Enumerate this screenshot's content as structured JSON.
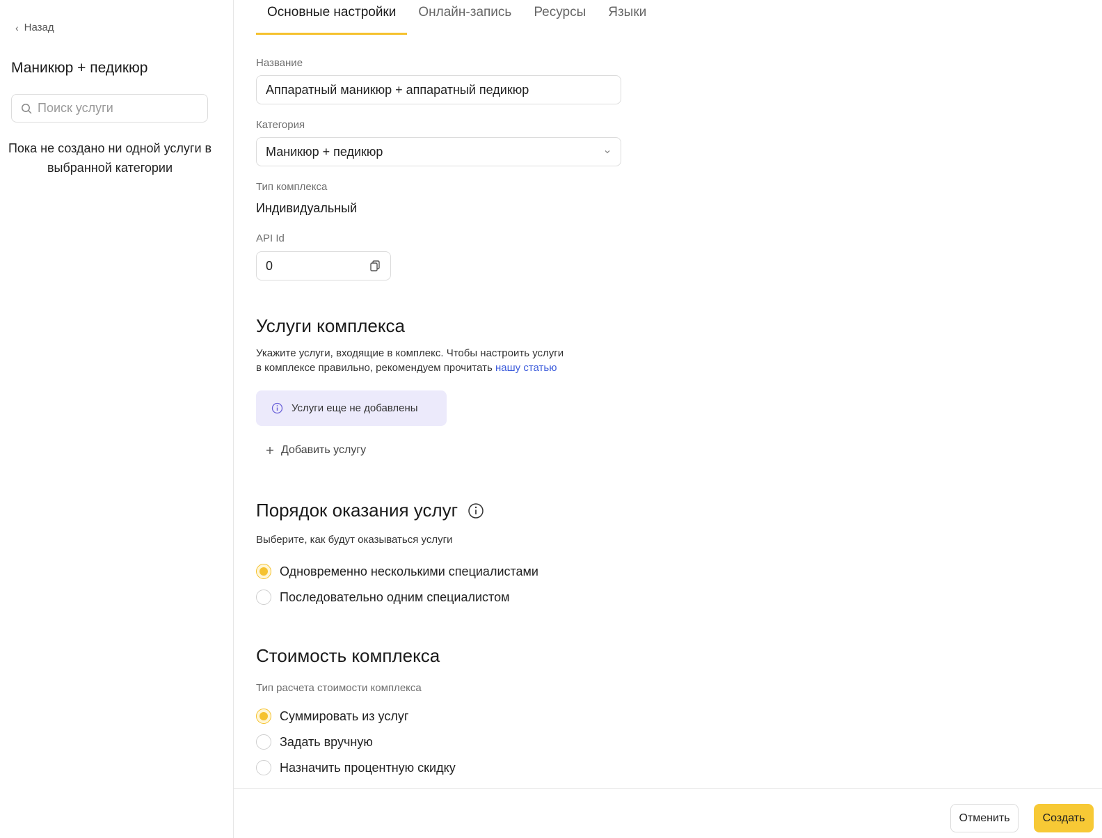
{
  "sidebar": {
    "back_label": "Назад",
    "title": "Маникюр + педикюр",
    "search_placeholder": "Поиск услуги",
    "empty_message": "Пока не создано ни одной услуги в выбранной категории"
  },
  "tabs": [
    {
      "label": "Основные настройки",
      "active": true
    },
    {
      "label": "Онлайн-запись",
      "active": false
    },
    {
      "label": "Ресурсы",
      "active": false
    },
    {
      "label": "Языки",
      "active": false
    }
  ],
  "form": {
    "name_label": "Название",
    "name_value": "Аппаратный маникюр + аппаратный педикюр",
    "category_label": "Категория",
    "category_value": "Маникюр + педикюр",
    "complex_type_label": "Тип комплекса",
    "complex_type_value": "Индивидуальный",
    "api_id_label": "API Id",
    "api_id_value": "0"
  },
  "services_section": {
    "title": "Услуги комплекса",
    "description_line1": "Укажите услуги, входящие в комплекс. Чтобы настроить услуги",
    "description_line2": "в комплексе правильно, рекомендуем прочитать ",
    "link_text": "нашу статью",
    "empty_info": "Услуги еще не добавлены",
    "add_button": "Добавить услугу"
  },
  "order_section": {
    "title": "Порядок оказания услуг",
    "subtitle": "Выберите, как будут оказываться услуги",
    "options": [
      {
        "label": "Одновременно несколькими специалистами",
        "checked": true
      },
      {
        "label": "Последовательно одним специалистом",
        "checked": false
      }
    ]
  },
  "cost_section": {
    "title": "Стоимость комплекса",
    "calc_label": "Тип расчета стоимости комплекса",
    "options": [
      {
        "label": "Суммировать из услуг",
        "checked": true
      },
      {
        "label": "Задать вручную",
        "checked": false
      },
      {
        "label": "Назначить процентную скидку",
        "checked": false
      }
    ]
  },
  "footer": {
    "cancel_label": "Отменить",
    "create_label": "Создать"
  },
  "colors": {
    "accent": "#f5c22f",
    "link": "#3b5bdb",
    "info_bg": "#eceafb"
  }
}
